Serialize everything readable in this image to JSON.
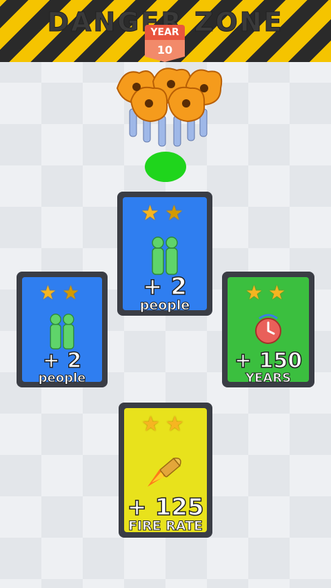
{
  "banner": {
    "title": "DANGER ZONE"
  },
  "year": {
    "label": "YEAR",
    "value": "10"
  },
  "cards": [
    {
      "id": "top",
      "amount": "+ 2",
      "label": "people",
      "color": "#2f7ef0"
    },
    {
      "id": "left",
      "amount": "+ 2",
      "label": "people",
      "color": "#2f7ef0"
    },
    {
      "id": "right",
      "amount": "+ 150",
      "label": "YEARS",
      "color": "#3bbf3f"
    },
    {
      "id": "bottom",
      "amount": "+ 125",
      "label": "FIRE RATE",
      "color": "#e8e21c"
    }
  ],
  "colors": {
    "stripe_yellow": "#f5c400",
    "stripe_black": "#2a2a2a",
    "start_circle": "#1fd51c",
    "star": "#f6b521"
  },
  "icons": [
    "star-icon",
    "people-icon",
    "clock-icon",
    "bullet-icon"
  ]
}
